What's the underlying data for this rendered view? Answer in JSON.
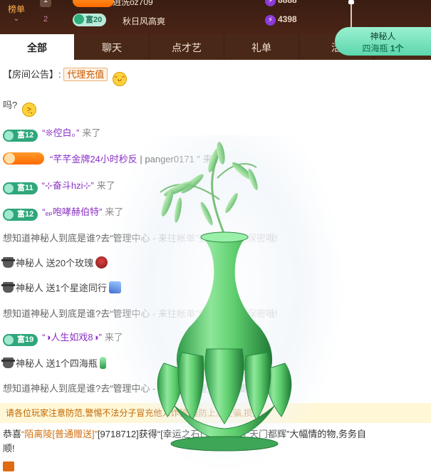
{
  "rank_panel": {
    "tab_label": "榜单",
    "rows": [
      {
        "rank": "1",
        "level": "",
        "name": "逍洗oz709",
        "score": "8888"
      },
      {
        "rank": "2",
        "level": "富20",
        "name": "秋日风高爽",
        "score": "4398"
      }
    ]
  },
  "mystery_pill": {
    "title": "神秘人",
    "gift": "四海瓶",
    "count": "1个"
  },
  "tabs": [
    "全部",
    "聊天",
    "点才艺",
    "礼单",
    "活"
  ],
  "chat": {
    "announcement_label": "【房间公告】:",
    "announcement_chip": "代理充值",
    "question_text": "吗?",
    "messages": [
      {
        "type": "enter",
        "level": "富12",
        "name": "“❊倥白。”",
        "action": "来了"
      },
      {
        "type": "enter-orange",
        "level": "",
        "name": "“芊芊金牌24小时秒反",
        "suffix": "| panger0171 ”",
        "action": "来了"
      },
      {
        "type": "enter",
        "level": "富11",
        "name": "“⊹奋斗hzi⊹”",
        "action": "来了"
      },
      {
        "type": "enter",
        "level": "富12",
        "name": "“ₑₚ咆哮赫伯特”",
        "action": "来了"
      },
      {
        "type": "system",
        "text": "想知道神秘人到底是谁?去“管理中心 - 来往帐单”查看,记得要保密哦!"
      },
      {
        "type": "gift",
        "sender": "神秘人",
        "text": "送20个玫瑰",
        "icon": "rose-icon"
      },
      {
        "type": "gift",
        "sender": "神秘人",
        "text": "送1个星途同行",
        "icon": "star-journey-icon"
      },
      {
        "type": "system",
        "text": "想知道神秘人到底是谁?去“管理中心 - 来往帐单”查看,记得要保密哦!"
      },
      {
        "type": "enter",
        "level": "富19",
        "name": "“◑人生如戏8◑”",
        "action": "来了"
      },
      {
        "type": "gift",
        "sender": "神秘人",
        "text": "送1个四海瓶",
        "icon": "vase-icon"
      },
      {
        "type": "system",
        "text": "想知道神秘人到底是谁?去“管理中心 - 来往帐单”查看,记得要保密哦!"
      }
    ],
    "warning": "请各位玩家注意防范,警惕不法分子冒充他人诈骗,谨防上当受骗,损失。",
    "bottom_line1_a": "恭喜",
    "bottom_line1_link": "“陌离陵[普通赠送]”",
    "bottom_line1_b": "[9718712]获得“[幸运之石]”[1个],获得“天门都辉”大幅情的物,务务自",
    "bottom_line2": "顺!"
  },
  "colors": {
    "accent_dark": "#4a2818",
    "level_badge": "#2fa77b",
    "username": "#8a2fc4",
    "warning_text": "#c06400"
  }
}
